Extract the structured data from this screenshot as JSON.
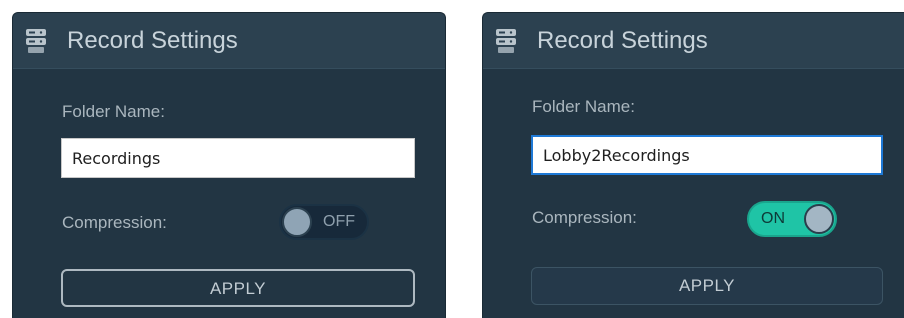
{
  "panels": [
    {
      "title": "Record Settings",
      "header_icon": "server-icon",
      "folder_label": "Folder Name:",
      "folder_value": "Recordings",
      "compression_label": "Compression:",
      "compression_state": "OFF",
      "apply_label": "APPLY"
    },
    {
      "title": "Record Settings",
      "header_icon": "server-icon",
      "folder_label": "Folder Name:",
      "folder_value": "Lobby2Recordings",
      "compression_label": "Compression:",
      "compression_state": "ON",
      "apply_label": "APPLY"
    }
  ],
  "colors": {
    "panel_bg": "#223543",
    "header_bg": "#2c4150",
    "toggle_on": "#1fc4a6",
    "toggle_off": "#17293a",
    "focus_border": "#1e79d6"
  }
}
